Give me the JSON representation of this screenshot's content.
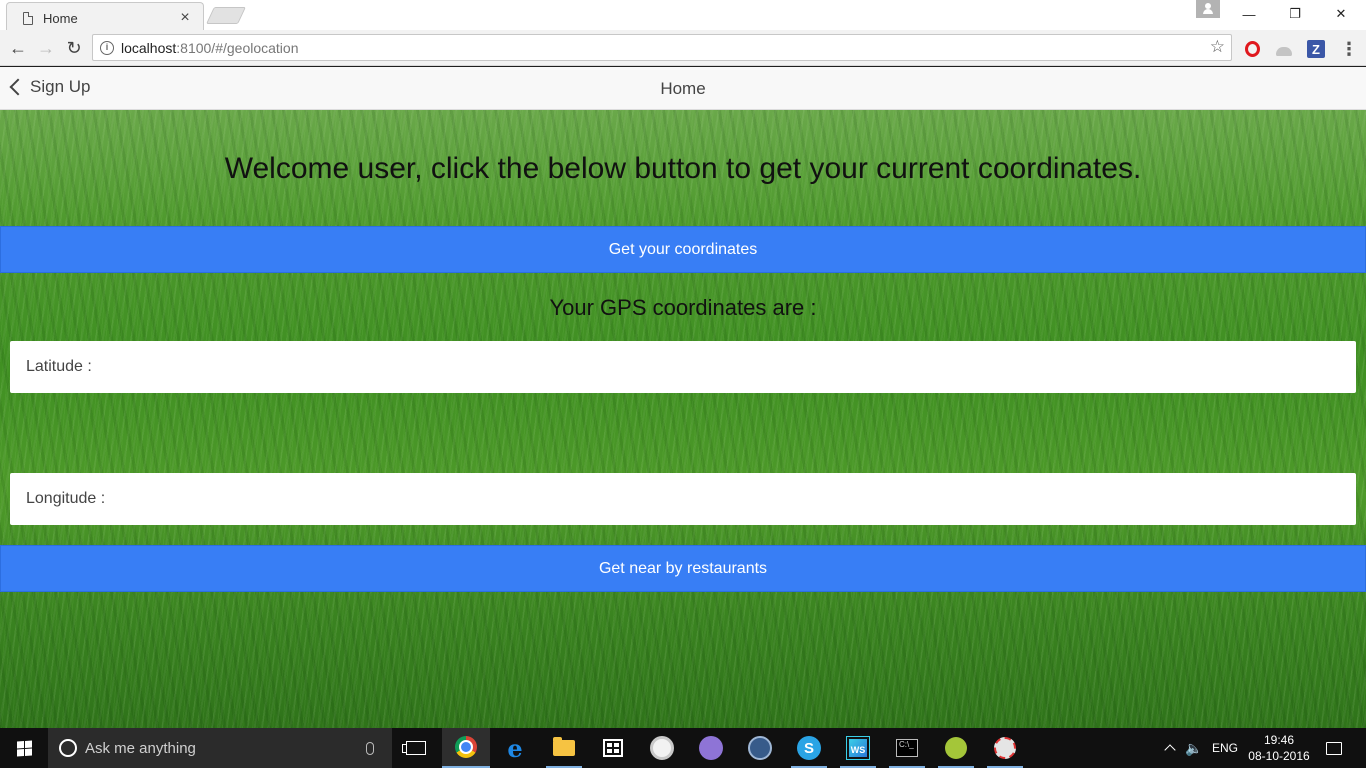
{
  "browser": {
    "tab_title": "Home",
    "url_host": "localhost",
    "url_path": ":8100/#/geolocation"
  },
  "header": {
    "back_label": "Sign Up",
    "title": "Home"
  },
  "content": {
    "welcome": "Welcome user, click the below button to get your current coordinates.",
    "get_coords_button": "Get your coordinates",
    "gps_heading": "Your GPS coordinates are :",
    "latitude_label": "Latitude :",
    "latitude_value": "",
    "longitude_label": "Longitude :",
    "longitude_value": "",
    "restaurants_button": "Get near by restaurants"
  },
  "taskbar": {
    "search_placeholder": "Ask me anything",
    "store_label": "",
    "lang": "ENG",
    "time": "19:46",
    "date": "08-10-2016"
  },
  "colors": {
    "primary": "#387ef5",
    "header_bg": "#f8f8f8",
    "taskbar_bg": "#101010"
  }
}
